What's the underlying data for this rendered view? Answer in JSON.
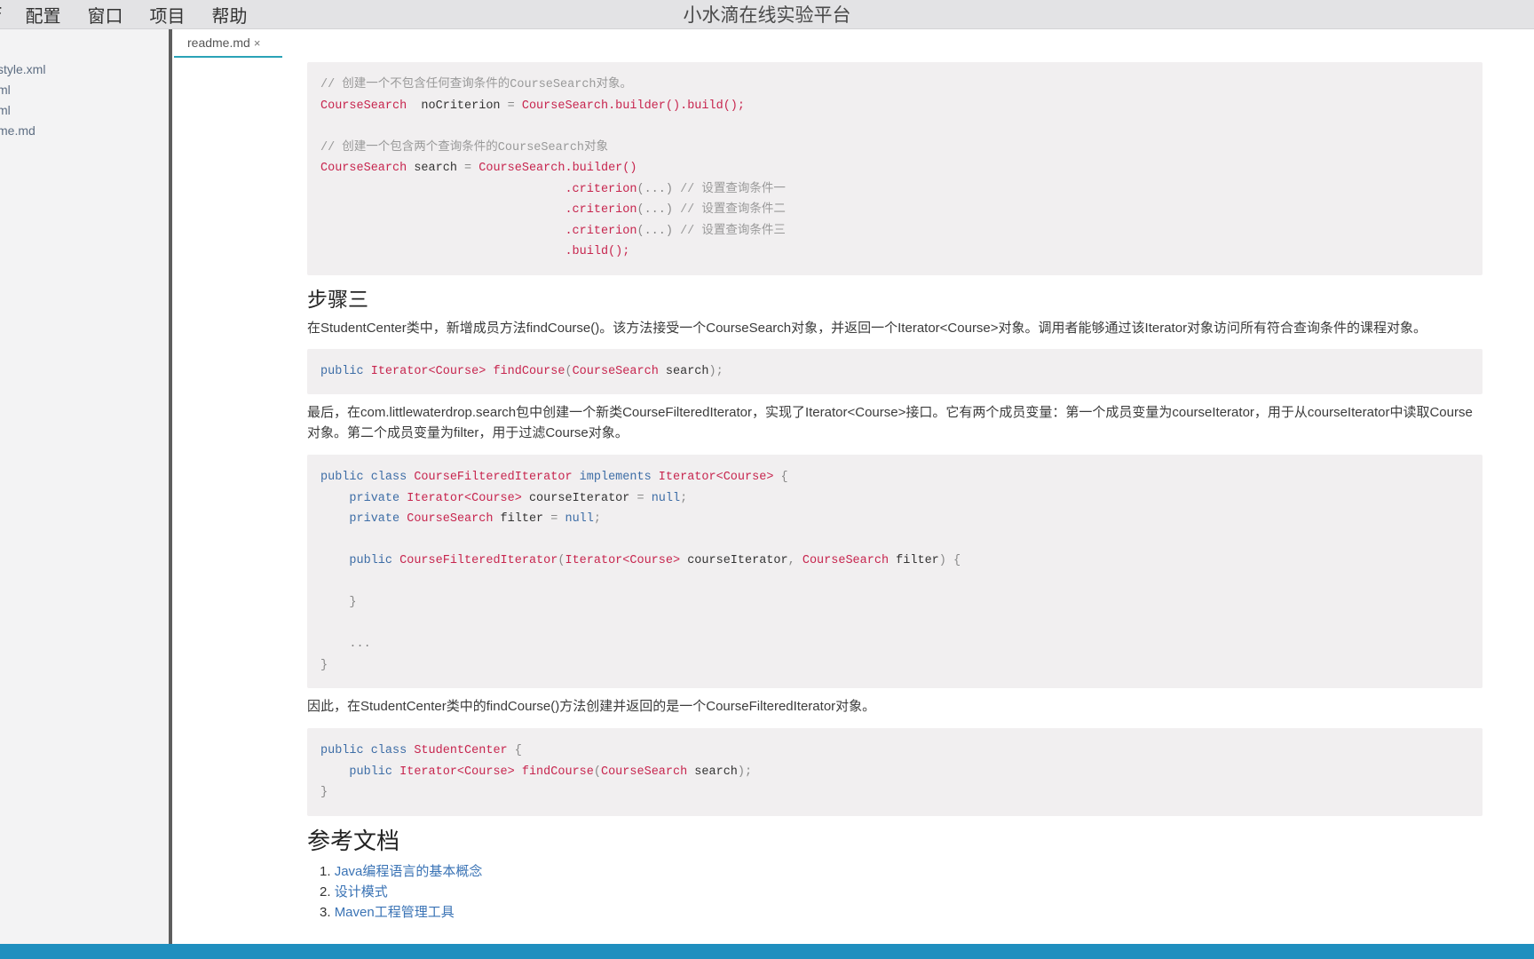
{
  "menu": {
    "items": [
      "F",
      "配置",
      "窗口",
      "项目",
      "帮助"
    ]
  },
  "app_title": "小水滴在线实验平台",
  "sidebar": {
    "files": [
      "style.xml",
      "ml",
      "ml",
      "me.md"
    ]
  },
  "tab": {
    "label": "readme.md",
    "close": "×"
  },
  "doc": {
    "code1": [
      [
        [
          "cm",
          "// 创建一个不包含任何查询条件的CourseSearch对象。"
        ]
      ],
      [
        [
          "ty",
          "CourseSearch"
        ],
        [
          "",
          "  noCriterion "
        ],
        [
          "pu",
          "="
        ],
        [
          "",
          " "
        ],
        [
          "ty",
          "CourseSearch"
        ],
        [
          "fn",
          ".builder().build();"
        ]
      ],
      [],
      [
        [
          "cm",
          "// 创建一个包含两个查询条件的CourseSearch对象"
        ]
      ],
      [
        [
          "ty",
          "CourseSearch"
        ],
        [
          "",
          " search "
        ],
        [
          "pu",
          "="
        ],
        [
          "",
          " "
        ],
        [
          "ty",
          "CourseSearch"
        ],
        [
          "fn",
          ".builder()"
        ]
      ],
      [
        [
          "",
          "                                  "
        ],
        [
          "fn",
          ".criterion"
        ],
        [
          "pu",
          "(...)"
        ],
        [
          "cm",
          " // 设置查询条件一"
        ]
      ],
      [
        [
          "",
          "                                  "
        ],
        [
          "fn",
          ".criterion"
        ],
        [
          "pu",
          "(...)"
        ],
        [
          "cm",
          " // 设置查询条件二"
        ]
      ],
      [
        [
          "",
          "                                  "
        ],
        [
          "fn",
          ".criterion"
        ],
        [
          "pu",
          "(...)"
        ],
        [
          "cm",
          " // 设置查询条件三"
        ]
      ],
      [
        [
          "",
          "                                  "
        ],
        [
          "fn",
          ".build();"
        ]
      ]
    ],
    "step3_title": "步骤三",
    "step3_text": "在StudentCenter类中，新增成员方法findCourse()。该方法接受一个CourseSearch对象，并返回一个Iterator<Course>对象。调用者能够通过该Iterator对象访问所有符合查询条件的课程对象。",
    "code2": [
      [
        [
          "kw",
          "public"
        ],
        [
          "",
          " "
        ],
        [
          "ty",
          "Iterator<Course>"
        ],
        [
          "",
          " "
        ],
        [
          "fn",
          "findCourse"
        ],
        [
          "pu",
          "("
        ],
        [
          "ty",
          "CourseSearch"
        ],
        [
          "",
          " search"
        ],
        [
          "pu",
          ");"
        ]
      ]
    ],
    "para2": "最后，在com.littlewaterdrop.search包中创建一个新类CourseFilteredIterator，实现了Iterator<Course>接口。它有两个成员变量：第一个成员变量为courseIterator，用于从courseIterator中读取Course对象。第二个成员变量为filter，用于过滤Course对象。",
    "code3": [
      [
        [
          "kw",
          "public class"
        ],
        [
          "",
          " "
        ],
        [
          "ty",
          "CourseFilteredIterator"
        ],
        [
          "",
          " "
        ],
        [
          "kw",
          "implements"
        ],
        [
          "",
          " "
        ],
        [
          "ty",
          "Iterator<Course>"
        ],
        [
          "pu",
          " {"
        ]
      ],
      [
        [
          "",
          "    "
        ],
        [
          "kw",
          "private"
        ],
        [
          "",
          " "
        ],
        [
          "ty",
          "Iterator<Course>"
        ],
        [
          "",
          " courseIterator "
        ],
        [
          "pu",
          "="
        ],
        [
          "",
          " "
        ],
        [
          "nu",
          "null"
        ],
        [
          "pu",
          ";"
        ]
      ],
      [
        [
          "",
          "    "
        ],
        [
          "kw",
          "private"
        ],
        [
          "",
          " "
        ],
        [
          "ty",
          "CourseSearch"
        ],
        [
          "",
          " filter "
        ],
        [
          "pu",
          "="
        ],
        [
          "",
          " "
        ],
        [
          "nu",
          "null"
        ],
        [
          "pu",
          ";"
        ]
      ],
      [],
      [
        [
          "",
          "    "
        ],
        [
          "kw",
          "public"
        ],
        [
          "",
          " "
        ],
        [
          "fn",
          "CourseFilteredIterator"
        ],
        [
          "pu",
          "("
        ],
        [
          "ty",
          "Iterator<Course>"
        ],
        [
          "",
          " courseIterator"
        ],
        [
          "pu",
          ","
        ],
        [
          "",
          " "
        ],
        [
          "ty",
          "CourseSearch"
        ],
        [
          "",
          " filter"
        ],
        [
          "pu",
          ") {"
        ]
      ],
      [],
      [
        [
          "",
          "    "
        ],
        [
          "pu",
          "}"
        ]
      ],
      [],
      [
        [
          "",
          "    "
        ],
        [
          "pu",
          "..."
        ]
      ],
      [
        [
          "pu",
          "}"
        ]
      ]
    ],
    "para3": "因此，在StudentCenter类中的findCourse()方法创建并返回的是一个CourseFilteredIterator对象。",
    "code4": [
      [
        [
          "kw",
          "public class"
        ],
        [
          "",
          " "
        ],
        [
          "ty",
          "StudentCenter"
        ],
        [
          "pu",
          " {"
        ]
      ],
      [
        [
          "",
          "    "
        ],
        [
          "kw",
          "public"
        ],
        [
          "",
          " "
        ],
        [
          "ty",
          "Iterator<Course>"
        ],
        [
          "",
          " "
        ],
        [
          "fn",
          "findCourse"
        ],
        [
          "pu",
          "("
        ],
        [
          "ty",
          "CourseSearch"
        ],
        [
          "",
          " search"
        ],
        [
          "pu",
          ");"
        ]
      ],
      [
        [
          "pu",
          "}"
        ]
      ]
    ],
    "ref_title": "参考文档",
    "refs": [
      {
        "num": "1.",
        "text": "Java编程语言的基本概念"
      },
      {
        "num": "2.",
        "text": "设计模式"
      },
      {
        "num": "3.",
        "text": "Maven工程管理工具"
      }
    ]
  },
  "colors": {
    "status_bar": "#1f8fbf",
    "tab_accent": "#2aa3b7",
    "code_bg": "#f1eff0",
    "link": "#3a73b5"
  }
}
